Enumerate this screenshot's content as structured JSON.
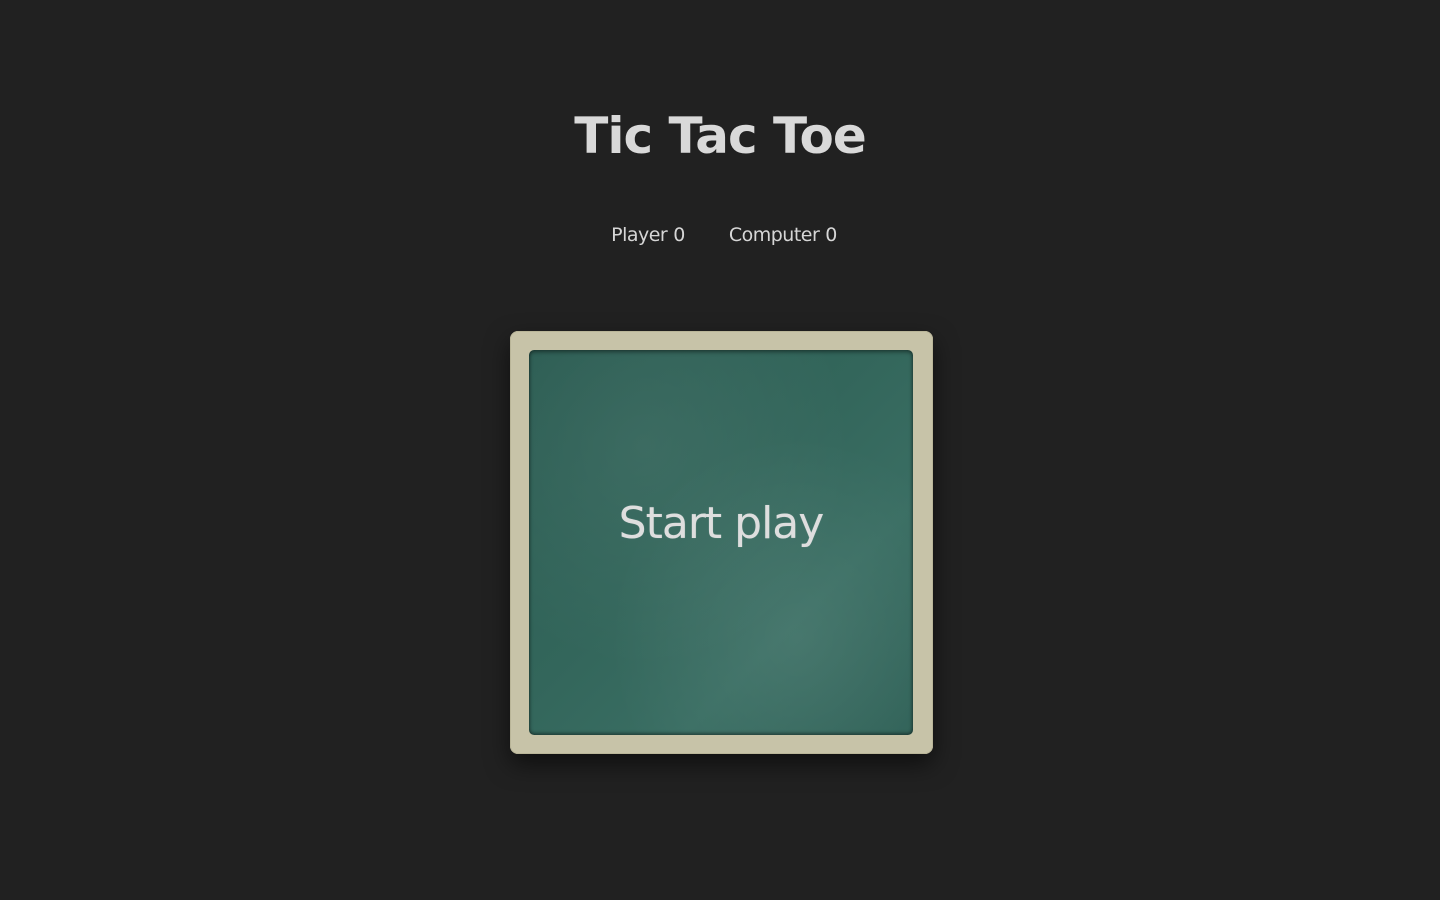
{
  "header": {
    "title": "Tic Tac Toe"
  },
  "scoreboard": {
    "player": {
      "label": "Player",
      "score": "0"
    },
    "computer": {
      "label": "Computer",
      "score": "0"
    }
  },
  "board": {
    "start_label": "Start play"
  },
  "colors": {
    "background": "#212121",
    "frame": "#c7c3a8",
    "chalkboard": "#33665b",
    "text": "#d9d9d9"
  }
}
